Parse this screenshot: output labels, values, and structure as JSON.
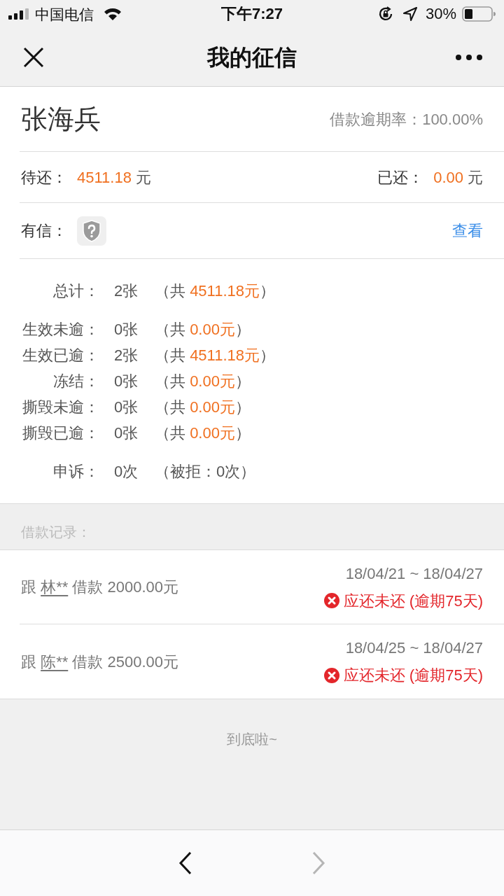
{
  "status_bar": {
    "carrier": "中国电信",
    "time": "下午7:27",
    "battery": "30%"
  },
  "nav_bar": {
    "title": "我的征信"
  },
  "profile": {
    "name": "张海兵",
    "overdue_rate": "借款逾期率：100.00%"
  },
  "balances": [
    {
      "label": "待还：",
      "amount": "4511.18",
      "unit": "元"
    },
    {
      "label": "已还：",
      "amount": "0.00",
      "unit": "元"
    }
  ],
  "youxin": {
    "label": "有信：",
    "link": "查看"
  },
  "summary_groups": [
    {
      "rows": [
        {
          "kind": "amount",
          "label": "总计：",
          "count": "2张",
          "prefix": "（共",
          "amount": "4511.18元",
          "suffix": "）"
        }
      ]
    },
    {
      "rows": [
        {
          "kind": "amount",
          "label": "生效未逾：",
          "count": "0张",
          "prefix": "（共",
          "amount": "0.00元",
          "suffix": "）"
        },
        {
          "kind": "amount",
          "label": "生效已逾：",
          "count": "2张",
          "prefix": "（共",
          "amount": "4511.18元",
          "suffix": "）"
        },
        {
          "kind": "amount",
          "label": "冻结：",
          "count": "0张",
          "prefix": "（共",
          "amount": "0.00元",
          "suffix": "）"
        },
        {
          "kind": "amount",
          "label": "撕毁未逾：",
          "count": "0张",
          "prefix": "（共",
          "amount": "0.00元",
          "suffix": "）"
        },
        {
          "kind": "amount",
          "label": "撕毁已逾：",
          "count": "0张",
          "prefix": "（共",
          "amount": "0.00元",
          "suffix": "）"
        }
      ]
    },
    {
      "rows": [
        {
          "kind": "note",
          "label": "申诉：",
          "count": "0次",
          "note": "（被拒：0次）"
        }
      ]
    }
  ],
  "records": {
    "header": "借款记录：",
    "items": [
      {
        "prefix": "跟",
        "lender": "林**",
        "description": "借款 2000.00元",
        "period": "18/04/21 ~ 18/04/27",
        "status": {
          "kind": "overdue",
          "text": "应还未还 (逾期75天)"
        }
      },
      {
        "prefix": "跟",
        "lender": "陈**",
        "description": "借款 2500.00元",
        "period": "18/04/25 ~ 18/04/27",
        "status": {
          "kind": "overdue",
          "text": "应还未还 (逾期75天)"
        }
      }
    ]
  },
  "footer": {
    "end_text": "到底啦~"
  },
  "toolbar": {
    "back": {
      "disabled": false
    },
    "forward": {
      "disabled": true
    }
  }
}
